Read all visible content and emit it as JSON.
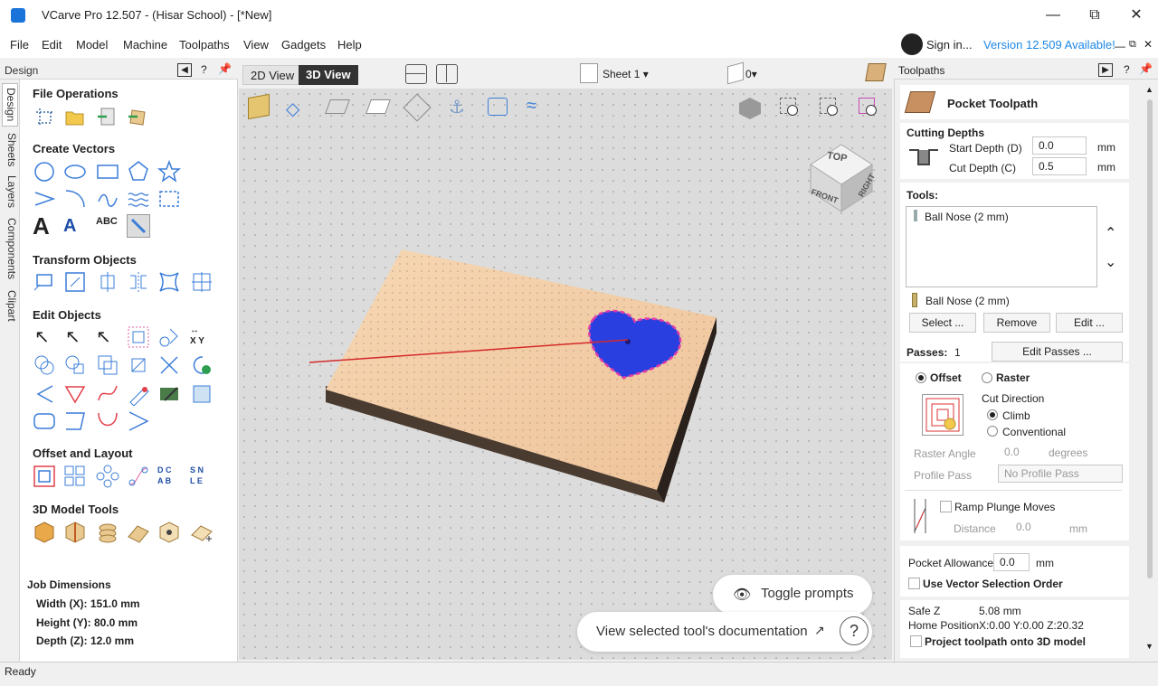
{
  "window": {
    "title": "VCarve Pro 12.507 - (Hisar School) - [*New]"
  },
  "menu": [
    "File",
    "Edit",
    "Model",
    "Machine",
    "Toolpaths",
    "View",
    "Gadgets",
    "Help"
  ],
  "account": {
    "signin": "Sign in...",
    "version_notice": "Version 12.509 Available!"
  },
  "left_panel": {
    "header": "Design",
    "vertical_tabs": [
      "Design",
      "Sheets",
      "Layers",
      "Components",
      "Clipart"
    ],
    "sections": {
      "file_ops": "File Operations",
      "create_vectors": "Create Vectors",
      "transform": "Transform Objects",
      "edit": "Edit Objects",
      "offset": "Offset and Layout",
      "model3d": "3D Model Tools"
    },
    "job": {
      "title": "Job Dimensions",
      "width": "Width  (X): 151.0 mm",
      "height": "Height (Y): 80.0 mm",
      "depth": "Depth  (Z): 12.0 mm"
    }
  },
  "view": {
    "tab_2d": "2D View",
    "tab_3d": "3D View",
    "sheet": "Sheet 1",
    "layer_count": "0",
    "cube_top": "TOP",
    "cube_front": "FRONT",
    "cube_right": "RIGHT",
    "toggle_prompts": "Toggle prompts",
    "doc_link": "View selected tool's documentation",
    "help": "?"
  },
  "right_panel": {
    "header": "Toolpaths",
    "title": "Pocket Toolpath",
    "cutting_depths": "Cutting Depths",
    "start_depth_label": "Start Depth (D)",
    "start_depth": "0.0",
    "cut_depth_label": "Cut Depth (C)",
    "cut_depth": "0.5",
    "unit": "mm",
    "tools_label": "Tools:",
    "tool_list": [
      "Ball Nose (2 mm)"
    ],
    "selected_tool": "Ball Nose (2 mm)",
    "select_btn": "Select ...",
    "remove_btn": "Remove",
    "edit_btn": "Edit ...",
    "passes_label": "Passes:",
    "passes": "1",
    "edit_passes_btn": "Edit Passes ...",
    "offset": "Offset",
    "raster": "Raster",
    "cut_direction": "Cut Direction",
    "climb": "Climb",
    "conventional": "Conventional",
    "raster_angle": "Raster Angle",
    "raster_angle_val": "0.0",
    "degrees": "degrees",
    "profile_pass": "Profile Pass",
    "profile_pass_val": "No Profile Pass",
    "ramp": "Ramp Plunge Moves",
    "distance": "Distance",
    "distance_val": "0.0",
    "pocket_allowance": "Pocket Allowance",
    "pocket_allowance_val": "0.0",
    "vector_order": "Use Vector Selection Order",
    "safe_z_label": "Safe Z",
    "safe_z": "5.08 mm",
    "home_label": "Home Position",
    "home": "X:0.00 Y:0.00 Z:20.32",
    "project": "Project toolpath onto 3D model"
  },
  "status": "Ready"
}
